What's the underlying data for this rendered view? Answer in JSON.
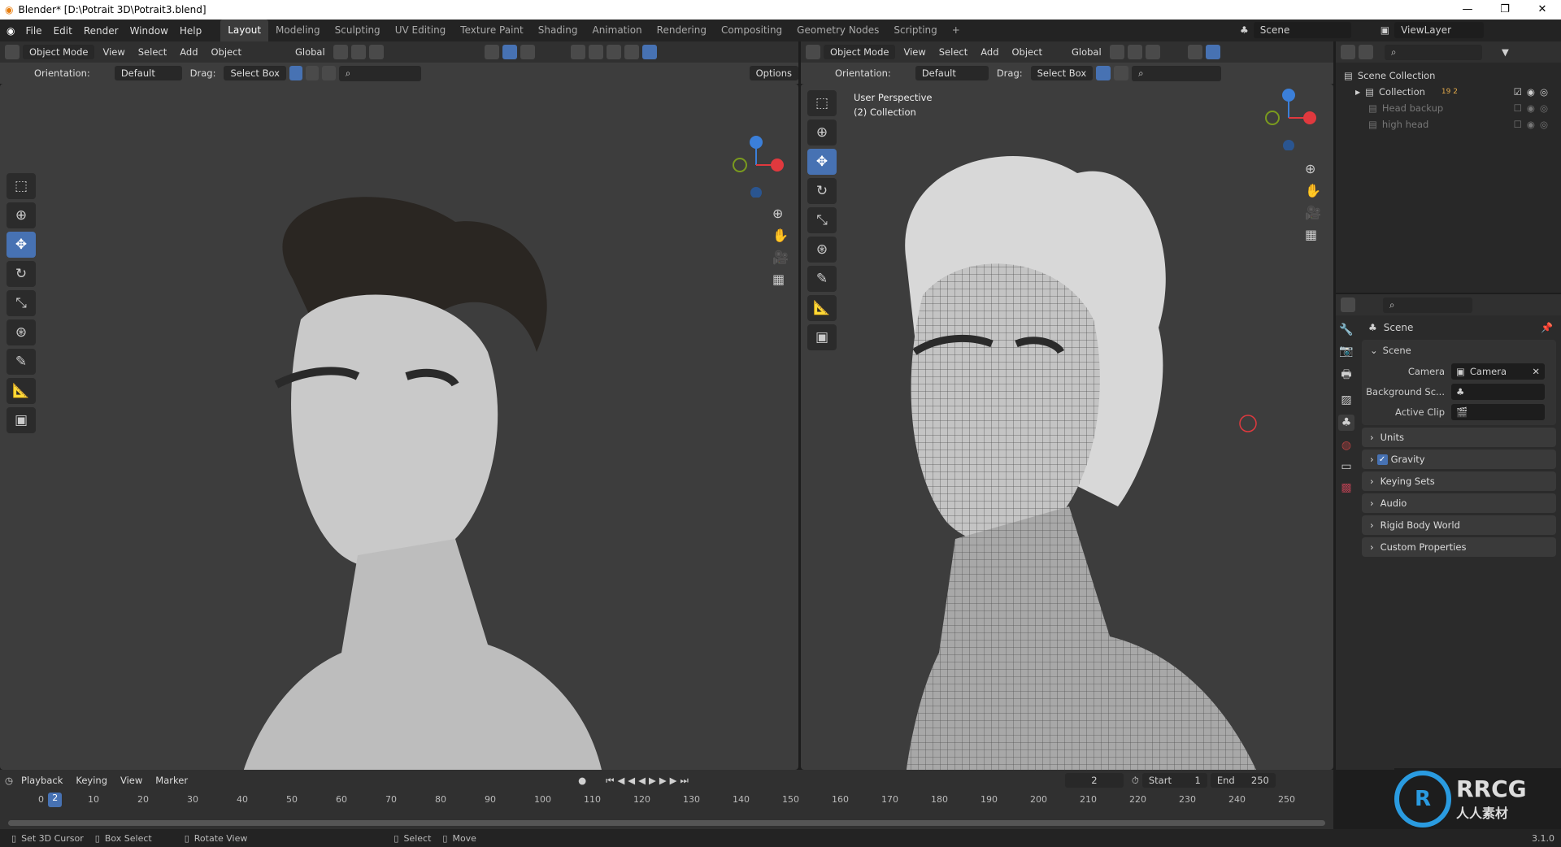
{
  "window": {
    "title": "Blender* [D:\\Potrait 3D\\Potrait3.blend]",
    "min": "—",
    "max": "❐",
    "close": "✕"
  },
  "menu": {
    "items": [
      "File",
      "Edit",
      "Render",
      "Window",
      "Help"
    ],
    "workspaces": [
      "Layout",
      "Modeling",
      "Sculpting",
      "UV Editing",
      "Texture Paint",
      "Shading",
      "Animation",
      "Rendering",
      "Compositing",
      "Geometry Nodes",
      "Scripting"
    ],
    "add_tab": "+",
    "scene": "Scene",
    "view_layer": "ViewLayer"
  },
  "viewport_header": {
    "mode": "Object Mode",
    "view": "View",
    "select": "Select",
    "add": "Add",
    "object": "Object",
    "transform": "Global",
    "options": "Options",
    "orientation_label": "Orientation:",
    "orientation": "Default",
    "drag_label": "Drag:",
    "drag": "Select Box"
  },
  "right_viewport": {
    "overlay_line1": "User Perspective",
    "overlay_line2": "(2) Collection"
  },
  "gizmo": {
    "z": "Z",
    "x": "X",
    "colors": {
      "x": "#e0393e",
      "y": "#7a9a1e",
      "z": "#3b7fd9"
    }
  },
  "outliner": {
    "root": "Scene Collection",
    "items": [
      {
        "name": "Collection",
        "badges": "19 2"
      },
      {
        "name": "Head backup"
      },
      {
        "name": "high head"
      }
    ]
  },
  "properties": {
    "header": "Scene",
    "section": "Scene",
    "fields": [
      {
        "label": "Camera",
        "value": "Camera"
      },
      {
        "label": "Background Sc...",
        "value": ""
      },
      {
        "label": "Active Clip",
        "value": ""
      }
    ],
    "panels": [
      "Units",
      "Gravity",
      "Keying Sets",
      "Audio",
      "Rigid Body World",
      "Custom Properties"
    ],
    "gravity_checked": true
  },
  "timeline": {
    "menus": [
      "Playback",
      "Keying",
      "View",
      "Marker"
    ],
    "current_frame": "2",
    "start_label": "Start",
    "start": "1",
    "end_label": "End",
    "end": "250",
    "ticks": [
      "0",
      "10",
      "20",
      "30",
      "40",
      "50",
      "60",
      "70",
      "80",
      "90",
      "100",
      "110",
      "120",
      "130",
      "140",
      "150",
      "160",
      "170",
      "180",
      "190",
      "200",
      "210",
      "220",
      "230",
      "240",
      "250"
    ]
  },
  "statusbar": {
    "items": [
      "Set 3D Cursor",
      "Box Select",
      "Rotate View",
      "Select",
      "Move"
    ],
    "version": "3.1.0"
  },
  "watermark": {
    "text": "RRCG",
    "sub": "人人素材"
  },
  "colors": {
    "accent": "#4772b3",
    "viewport_bg": "#3d3d3d",
    "header": "#303030"
  }
}
